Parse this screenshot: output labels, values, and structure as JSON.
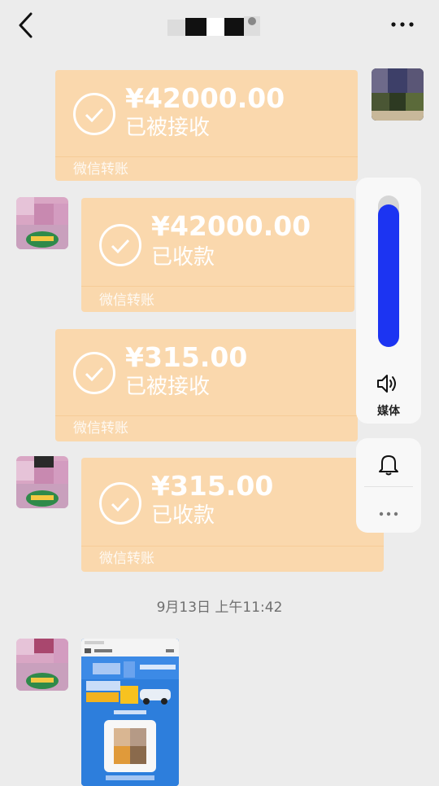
{
  "header": {
    "back_icon": "chevron-left-icon",
    "more_icon": "ellipsis-icon"
  },
  "messages": [
    {
      "amount": "¥42000.00",
      "status": "已被接收",
      "footer": "微信转账"
    },
    {
      "amount": "¥42000.00",
      "status": "已收款",
      "footer": "微信转账"
    },
    {
      "amount": "¥315.00",
      "status": "已被接收",
      "footer": "微信转账"
    },
    {
      "amount": "¥315.00",
      "status": "已收款",
      "footer": "微信转账"
    }
  ],
  "timestamp": "9月13日 上午11:42",
  "volume_panel": {
    "label": "媒体",
    "level": 0.94,
    "speaker_icon": "speaker-icon",
    "bell_icon": "bell-icon",
    "more_icon": "ellipsis-icon"
  },
  "colors": {
    "card_bg": "#fad8ad",
    "volume_fill": "#1c34f2",
    "background": "#ececec"
  }
}
